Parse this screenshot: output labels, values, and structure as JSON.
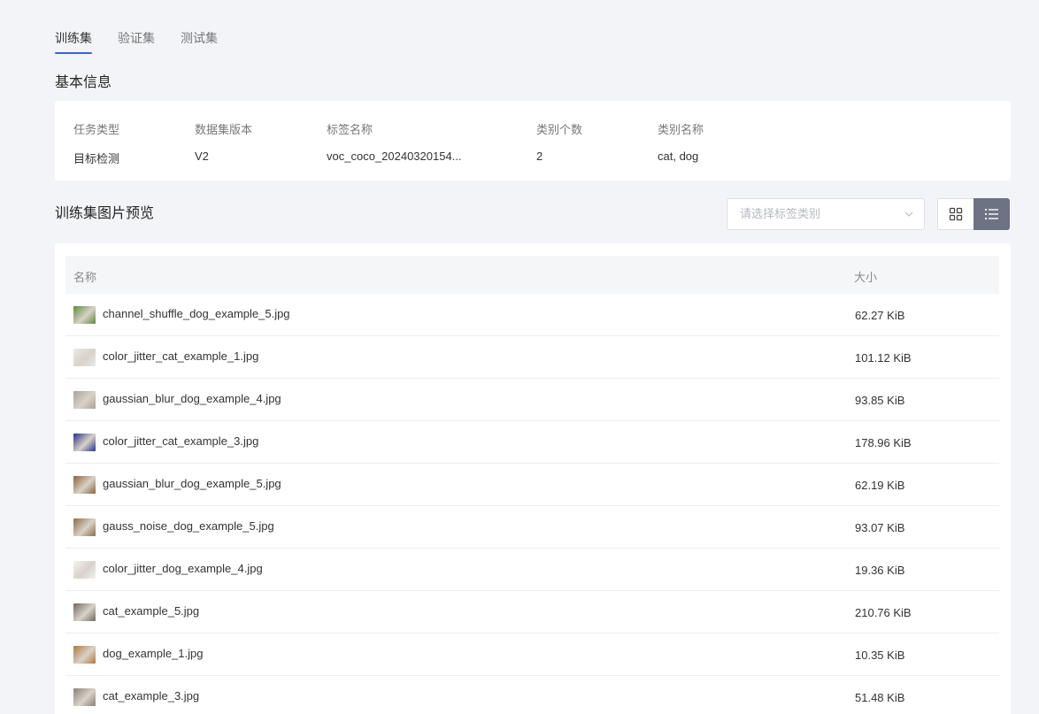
{
  "tabs": [
    {
      "label": "训练集",
      "active": true
    },
    {
      "label": "验证集",
      "active": false
    },
    {
      "label": "测试集",
      "active": false
    }
  ],
  "basic_info": {
    "title": "基本信息",
    "fields": [
      {
        "label": "任务类型",
        "value": "目标检测"
      },
      {
        "label": "数据集版本",
        "value": "V2"
      },
      {
        "label": "标签名称",
        "value": "voc_coco_20240320154..."
      },
      {
        "label": "类别个数",
        "value": "2"
      },
      {
        "label": "类别名称",
        "value": "cat, dog"
      }
    ]
  },
  "preview": {
    "title": "训练集图片预览",
    "select_placeholder": "请选择标签类别",
    "view_mode": "list"
  },
  "table": {
    "columns": [
      "名称",
      "大小"
    ],
    "rows": [
      {
        "name": "channel_shuffle_dog_example_5.jpg",
        "size": "62.27 KiB",
        "thumb_color": "#5d8a3a"
      },
      {
        "name": "color_jitter_cat_example_1.jpg",
        "size": "101.12 KiB",
        "thumb_color": "#e9e9e9"
      },
      {
        "name": "gaussian_blur_dog_example_4.jpg",
        "size": "93.85 KiB",
        "thumb_color": "#a9a29a"
      },
      {
        "name": "color_jitter_cat_example_3.jpg",
        "size": "178.96 KiB",
        "thumb_color": "#2a2f8a"
      },
      {
        "name": "gaussian_blur_dog_example_5.jpg",
        "size": "62.19 KiB",
        "thumb_color": "#8a6238"
      },
      {
        "name": "gauss_noise_dog_example_5.jpg",
        "size": "93.07 KiB",
        "thumb_color": "#8c6a45"
      },
      {
        "name": "color_jitter_dog_example_4.jpg",
        "size": "19.36 KiB",
        "thumb_color": "#f2f2f2"
      },
      {
        "name": "cat_example_5.jpg",
        "size": "210.76 KiB",
        "thumb_color": "#6e6860"
      },
      {
        "name": "dog_example_1.jpg",
        "size": "10.35 KiB",
        "thumb_color": "#b6763a"
      },
      {
        "name": "cat_example_3.jpg",
        "size": "51.48 KiB",
        "thumb_color": "#8b8075"
      }
    ]
  },
  "icons": {
    "select_arrow": "chevron-down-icon",
    "grid_view": "grid-view-icon",
    "list_view": "list-view-icon"
  }
}
